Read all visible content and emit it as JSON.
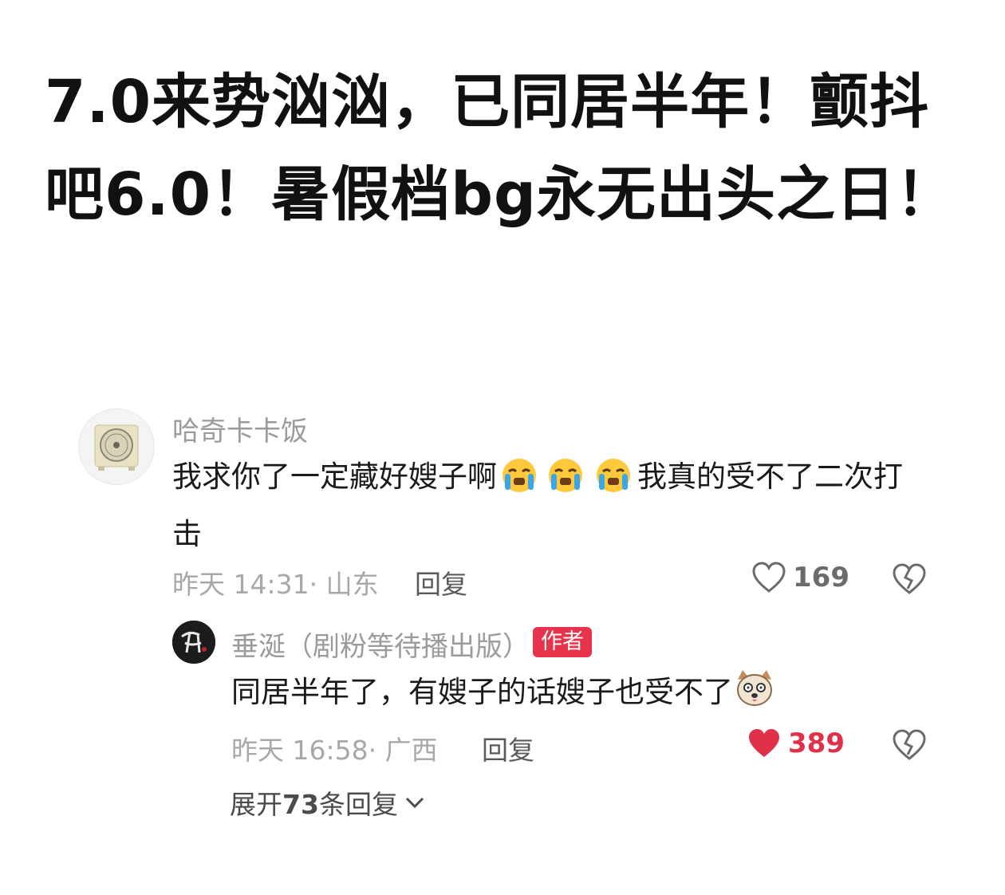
{
  "headline": "7.0来势汹汹，已同居半年！颤抖吧6.0！暑假档bg永无出头之日！",
  "comment": {
    "username": "哈奇卡卡饭",
    "text_before_emoji": "我求你了一定藏好嫂子啊",
    "text_after_emoji": "我真的受不了二次打击",
    "emojis": [
      "crying-face-icon",
      "crying-face-icon",
      "crying-face-icon"
    ],
    "time": "昨天 14:31",
    "location": "· 山东",
    "reply_label": "回复",
    "likes": "169"
  },
  "reply": {
    "username": "垂涎（剧粉等待播出版）",
    "badge": "作者",
    "text": "同居半年了，有嫂子的话嫂子也受不了",
    "emoji": "dog-face-icon",
    "time": "昨天 16:58",
    "location": "· 广西",
    "reply_label": "回复",
    "likes": "389",
    "liked": true,
    "like_color": "#e0304a"
  },
  "expand": {
    "prefix": "展开",
    "count": "73",
    "suffix": "条回复"
  }
}
